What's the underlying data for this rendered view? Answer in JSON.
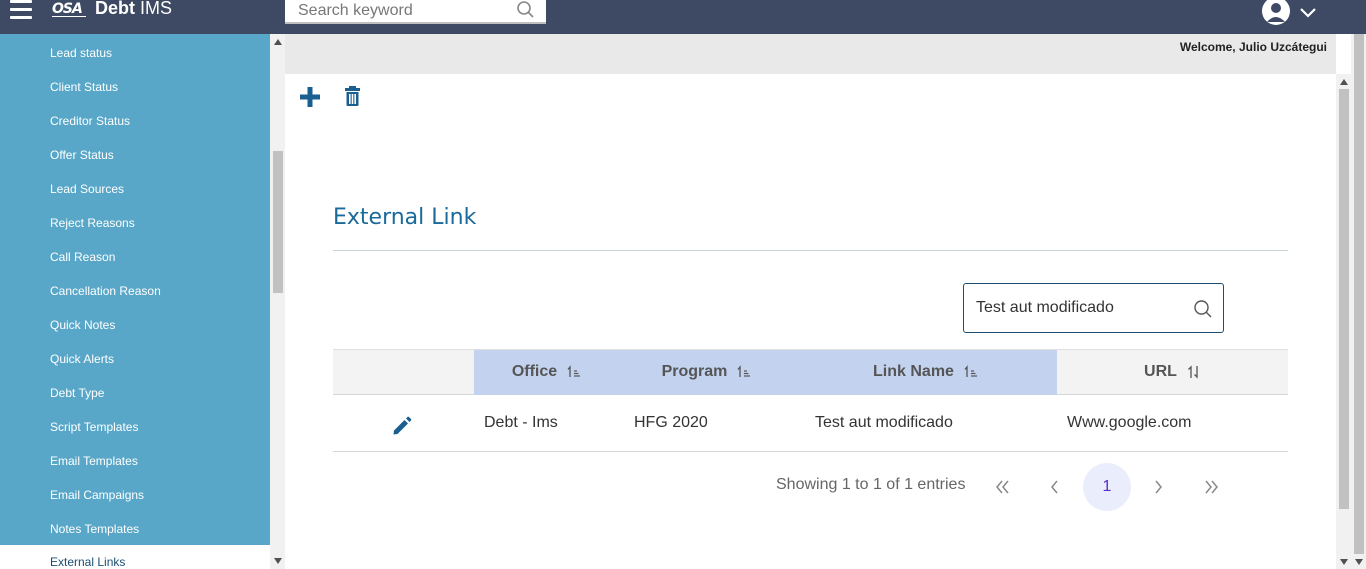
{
  "app": {
    "logo": "OSA",
    "title_bold": "Debt",
    "title_rest": " IMS"
  },
  "search": {
    "placeholder": "Search keyword",
    "value": ""
  },
  "header": {
    "welcome": "Welcome, Julio Uzcátegui"
  },
  "sidebar": {
    "items": [
      {
        "label": "Lead status"
      },
      {
        "label": "Client Status"
      },
      {
        "label": "Creditor Status"
      },
      {
        "label": "Offer Status"
      },
      {
        "label": "Lead Sources"
      },
      {
        "label": "Reject Reasons"
      },
      {
        "label": "Call Reason"
      },
      {
        "label": "Cancellation Reason"
      },
      {
        "label": "Quick Notes"
      },
      {
        "label": "Quick Alerts"
      },
      {
        "label": "Debt Type"
      },
      {
        "label": "Script Templates"
      },
      {
        "label": "Email Templates"
      },
      {
        "label": "Email Campaigns"
      },
      {
        "label": "Notes Templates"
      },
      {
        "label": "External Links",
        "active": true
      }
    ]
  },
  "toolbar": {
    "add_icon": "plus-icon",
    "delete_icon": "trash-icon"
  },
  "page": {
    "title": "External Link"
  },
  "filter": {
    "value": "Test aut modificado"
  },
  "table": {
    "columns": [
      {
        "label": "Office",
        "sorted": true
      },
      {
        "label": "Program",
        "sorted": true
      },
      {
        "label": "Link Name",
        "sorted": true
      },
      {
        "label": "URL",
        "sorted": false
      }
    ],
    "rows": [
      {
        "office": "Debt - Ims",
        "program": "HFG 2020",
        "link_name": "Test aut modificado",
        "url": "Www.google.com"
      }
    ]
  },
  "pagination": {
    "summary": "Showing 1 to 1 of 1 entries",
    "current_page": "1"
  },
  "colors": {
    "topbar": "#3e4a63",
    "sidebar": "#58a7c8",
    "accent": "#1a6a9a",
    "sorted_header": "#c3d3ef"
  }
}
